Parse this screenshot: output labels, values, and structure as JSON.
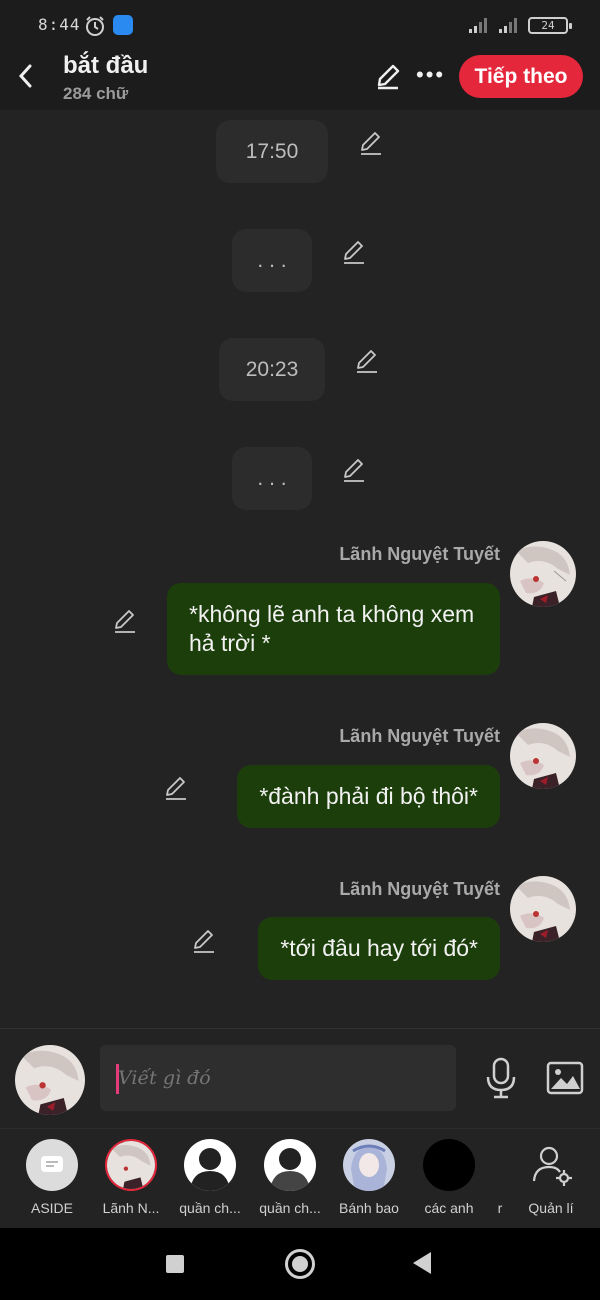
{
  "status_bar": {
    "time": "8:44",
    "battery": "24",
    "icons": [
      "alarm-icon",
      "app-notification-icon",
      "signal-icon",
      "battery-icon"
    ]
  },
  "header": {
    "title": "bắt đầu",
    "word_count": "284 chữ",
    "next_label": "Tiếp theo",
    "icons": [
      "back-icon",
      "edit-icon",
      "more-icon"
    ]
  },
  "messages": [
    {
      "type": "system",
      "text": "17:50"
    },
    {
      "type": "system",
      "text": ". . ."
    },
    {
      "type": "system",
      "text": "20:23"
    },
    {
      "type": "system",
      "text": ". . ."
    },
    {
      "type": "character",
      "speaker": "Lãnh Nguyệt Tuyết",
      "text": "*không lẽ anh ta không xem hả trời *"
    },
    {
      "type": "character",
      "speaker": "Lãnh Nguyệt Tuyết",
      "text": "*đành phải đi bộ thôi*"
    },
    {
      "type": "character",
      "speaker": "Lãnh Nguyệt Tuyết",
      "text": "*tới đâu hay tới đó*"
    }
  ],
  "composer": {
    "placeholder": "Viết gì đó",
    "icons": [
      "mic-icon",
      "image-icon"
    ]
  },
  "characters": [
    {
      "label": "ASIDE",
      "icon": "aside-icon"
    },
    {
      "label": "Lãnh N...",
      "icon": "avatar"
    },
    {
      "label": "quần ch...",
      "icon": "silhouette-avatar"
    },
    {
      "label": "quần ch...",
      "icon": "silhouette-avatar"
    },
    {
      "label": "Bánh bao",
      "icon": "avatar"
    },
    {
      "label": "các anh",
      "icon": "avatar"
    },
    {
      "label": "r",
      "icon": ""
    },
    {
      "label": "Quản lí",
      "icon": "manage-characters-icon"
    }
  ],
  "colors": {
    "accent": "#e5273c",
    "bubble": "#1c3e0b",
    "background": "#232323"
  }
}
